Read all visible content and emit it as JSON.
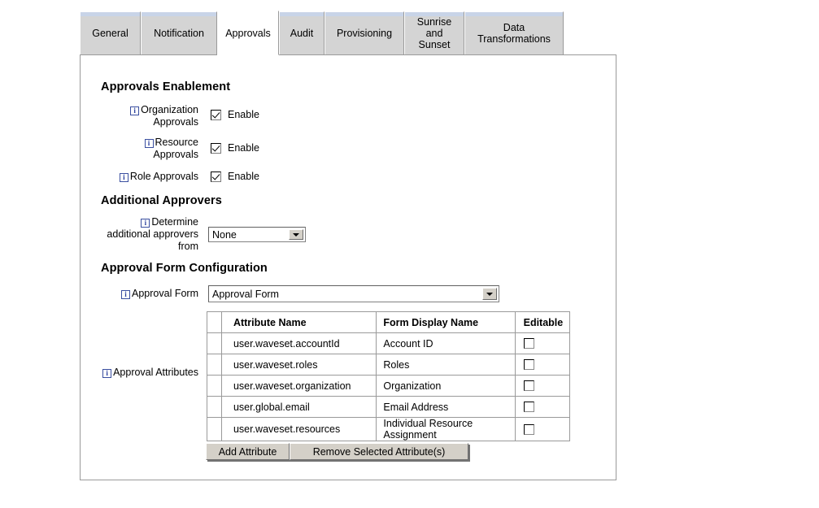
{
  "tabs": [
    {
      "label": "General",
      "active": false
    },
    {
      "label": "Notification",
      "active": false
    },
    {
      "label": "Approvals",
      "active": true
    },
    {
      "label": "Audit",
      "active": false
    },
    {
      "label": "Provisioning",
      "active": false
    },
    {
      "label": "Sunrise\nand\nSunset",
      "active": false
    },
    {
      "label": "Data\nTransformations",
      "active": false
    }
  ],
  "sections": {
    "enablement": {
      "heading": "Approvals Enablement",
      "rows": [
        {
          "label": "Organization\nApprovals",
          "checkbox_label": "Enable",
          "checked": true
        },
        {
          "label": "Resource\nApprovals",
          "checkbox_label": "Enable",
          "checked": true
        },
        {
          "label": "Role Approvals",
          "checkbox_label": "Enable",
          "checked": true
        }
      ]
    },
    "additional_approvers": {
      "heading": "Additional Approvers",
      "label": "Determine\nadditional approvers\nfrom",
      "select_value": "None"
    },
    "form_config": {
      "heading": "Approval Form Configuration",
      "form_label": "Approval Form",
      "form_select_value": "Approval Form",
      "attributes_label": "Approval Attributes",
      "table": {
        "headers": [
          "",
          "Attribute Name",
          "Form Display Name",
          "Editable"
        ],
        "rows": [
          {
            "name": "user.waveset.accountId",
            "display": "Account ID",
            "editable": false
          },
          {
            "name": "user.waveset.roles",
            "display": "Roles",
            "editable": false
          },
          {
            "name": "user.waveset.organization",
            "display": "Organization",
            "editable": false
          },
          {
            "name": "user.global.email",
            "display": "Email Address",
            "editable": false
          },
          {
            "name": "user.waveset.resources",
            "display": "Individual Resource Assignment",
            "editable": false
          }
        ]
      },
      "buttons": {
        "add": "Add Attribute",
        "remove": "Remove Selected Attribute(s)"
      }
    }
  },
  "icons": {
    "info": "i",
    "dropdown": "chevron-down-icon"
  },
  "colors": {
    "tab_inactive_bg": "#d4d4d4",
    "tab_active_bg": "#ffffff",
    "tab_top_accent": "#c8d4e8",
    "panel_border": "#9a9a9a",
    "info_icon": "#2a3f9d",
    "button_face": "#d4d0c8"
  }
}
